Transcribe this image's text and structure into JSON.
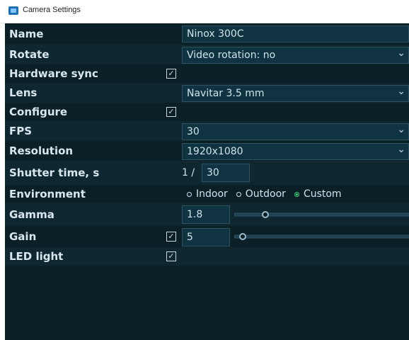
{
  "window": {
    "title": "Camera Settings"
  },
  "rows": {
    "name": {
      "label": "Name",
      "value": "Ninox 300C"
    },
    "rotate": {
      "label": "Rotate",
      "value": "Video rotation: no"
    },
    "hardware_sync": {
      "label": "Hardware sync",
      "checked": true
    },
    "lens": {
      "label": "Lens",
      "value": "Navitar 3.5 mm"
    },
    "configure": {
      "label": "Configure",
      "checked": true
    },
    "fps": {
      "label": "FPS",
      "value": "30"
    },
    "resolution": {
      "label": "Resolution",
      "value": "1920x1080"
    },
    "shutter": {
      "label": "Shutter time, s",
      "prefix": "1 /",
      "value": "30"
    },
    "environment": {
      "label": "Environment",
      "options": [
        "Indoor",
        "Outdoor",
        "Custom"
      ],
      "selected": "Custom"
    },
    "gamma": {
      "label": "Gamma",
      "value": "1.8",
      "slider_level": 0.18
    },
    "gain": {
      "label": "Gain",
      "checked": true,
      "value": "5",
      "slider_level": 0.05
    },
    "led": {
      "label": "LED light",
      "checked": true
    }
  },
  "icons": {
    "window": "camera-settings-icon",
    "check": "checkbox-checked-icon",
    "dropdown": "chevron-down-icon"
  },
  "colors": {
    "panel": "#0b1f27",
    "field": "#0f3341",
    "accent": "#3dd07c"
  }
}
